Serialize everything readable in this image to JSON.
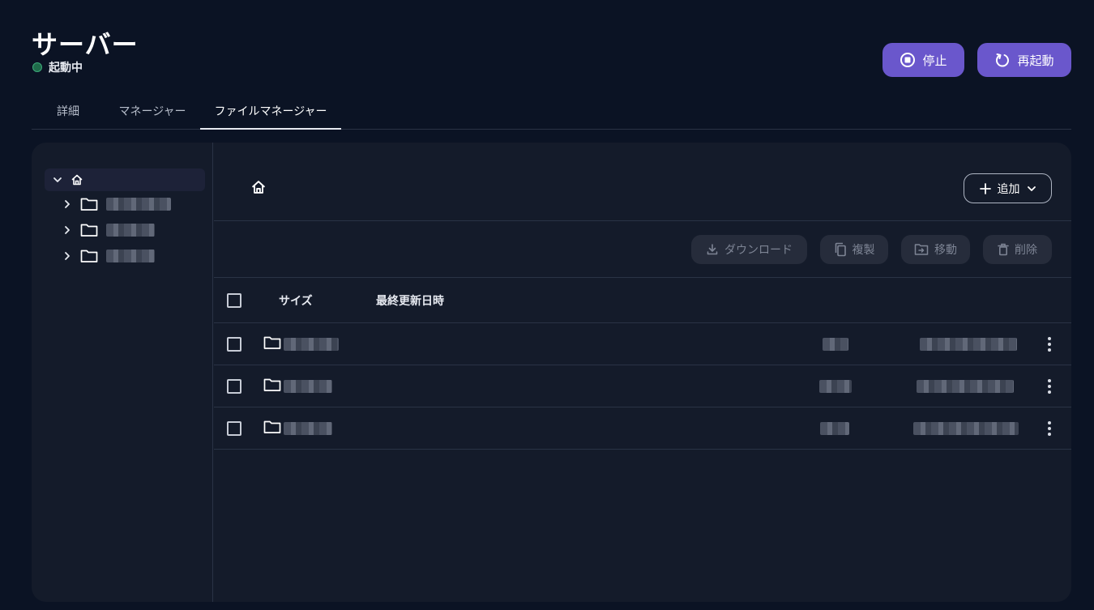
{
  "header": {
    "title": "サーバー",
    "status_label": "起動中",
    "status_color": "#3ea97a",
    "stop_label": "停止",
    "restart_label": "再起動",
    "accent_color": "#6a57cc"
  },
  "tabs": [
    {
      "label": "詳細",
      "active": false
    },
    {
      "label": "マネージャー",
      "active": false
    },
    {
      "label": "ファイルマネージャー",
      "active": true
    }
  ],
  "tree": {
    "root_icon": "home-icon",
    "root_expanded": true,
    "folder_icon": "folder-icon"
  },
  "file_manager": {
    "breadcrumb_icon": "home-icon",
    "add_label": "追加",
    "actions": {
      "download": "ダウンロード",
      "copy": "複製",
      "move": "移動",
      "delete": "削除"
    },
    "columns": {
      "name": "",
      "size": "サイズ",
      "modified": "最終更新日時"
    },
    "row_type_icon": "folder-icon"
  }
}
